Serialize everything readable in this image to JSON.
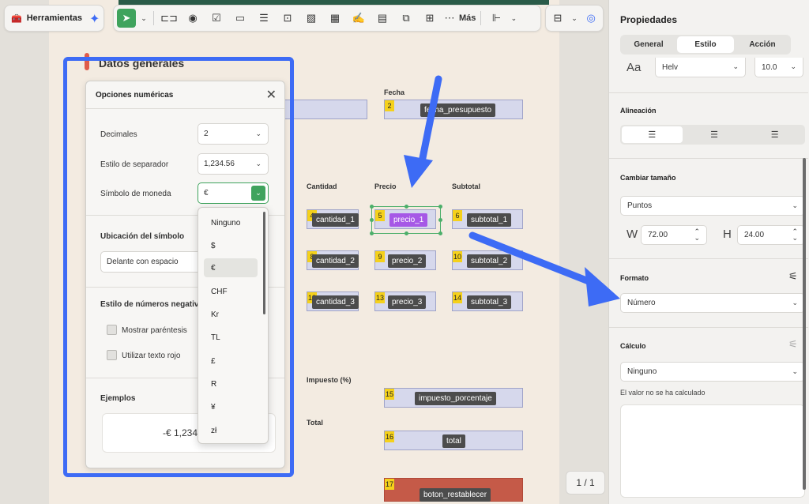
{
  "toolbar": {
    "tools_label": "Herramientas",
    "more_label": "Más"
  },
  "form": {
    "heading": "Datos generales",
    "labels": {
      "fecha": "Fecha",
      "cantidad": "Cantidad",
      "precio": "Precio",
      "subtotal": "Subtotal",
      "impuesto": "Impuesto (%)",
      "total": "Total"
    },
    "fields": [
      {
        "num": "2",
        "name": "fecha_presupuesto"
      },
      {
        "num": "4",
        "name": "cantidad_1"
      },
      {
        "num": "5",
        "name": "precio_1"
      },
      {
        "num": "6",
        "name": "subtotal_1"
      },
      {
        "num": "8",
        "name": "cantidad_2"
      },
      {
        "num": "9",
        "name": "precio_2"
      },
      {
        "num": "10",
        "name": "subtotal_2"
      },
      {
        "num": "12",
        "name": "cantidad_3"
      },
      {
        "num": "13",
        "name": "precio_3"
      },
      {
        "num": "14",
        "name": "subtotal_3"
      },
      {
        "num": "15",
        "name": "impuesto_porcentaje"
      },
      {
        "num": "16",
        "name": "total"
      },
      {
        "num": "17",
        "name": "boton_restablecer"
      }
    ],
    "page_indicator": "1 / 1"
  },
  "modal": {
    "title": "Opciones numéricas",
    "decimals_label": "Decimales",
    "decimals_value": "2",
    "separator_label": "Estilo de separador",
    "separator_value": "1,234.56",
    "currency_label": "Símbolo de moneda",
    "currency_value": "€",
    "placement_label": "Ubicación del símbolo",
    "placement_value": "Delante con espacio",
    "negative_label": "Estilo de números negativo",
    "show_parens_label": "Mostrar paréntesis",
    "red_text_label": "Utilizar texto rojo",
    "examples_label": "Ejemplos",
    "example_value": "-€ 1,234."
  },
  "currency_dropdown": {
    "options": [
      "Ninguno",
      "$",
      "€",
      "CHF",
      "Kr",
      "TL",
      "£",
      "R",
      "¥",
      "zł"
    ],
    "selected": "€"
  },
  "panel": {
    "title": "Propiedades",
    "tabs": [
      "General",
      "Estilo",
      "Acción"
    ],
    "active_tab": "Estilo",
    "font_icon": "Aa",
    "font_value": "Helv",
    "font_size": "10.0",
    "align_label": "Alineación",
    "resize_label": "Cambiar tamaño",
    "resize_unit": "Puntos",
    "w_label": "W",
    "w_value": "72.00",
    "h_label": "H",
    "h_value": "24.00",
    "format_label": "Formato",
    "format_value": "Número",
    "calc_label": "Cálculo",
    "calc_value": "Ninguno",
    "calc_hint": "El valor no se ha calculado"
  },
  "colors": {
    "accent_green": "#3fa35d",
    "highlight_blue": "#3d6bf5",
    "field_purple": "#a658e6"
  }
}
